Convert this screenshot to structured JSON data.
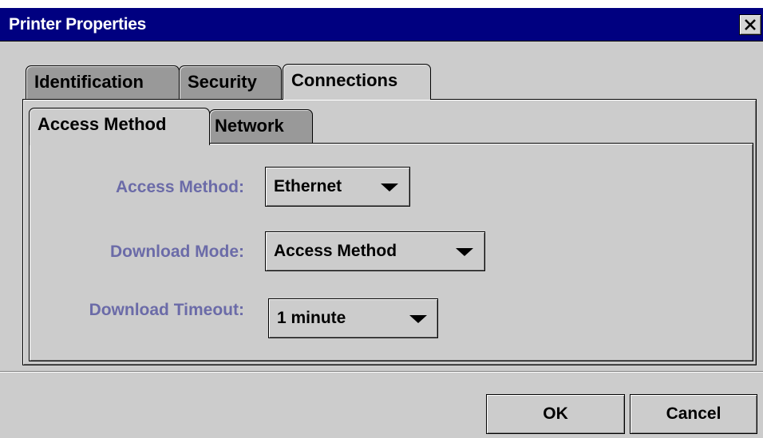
{
  "window": {
    "title": "Printer Properties",
    "close_icon": "close-icon"
  },
  "tabs": [
    {
      "label": "Identification",
      "active": false
    },
    {
      "label": "Security",
      "active": false
    },
    {
      "label": "Connections",
      "active": true
    }
  ],
  "subtabs": [
    {
      "label": "Access Method",
      "active": true
    },
    {
      "label": "Network",
      "active": false
    }
  ],
  "form": {
    "access_method": {
      "label": "Access Method:",
      "value": "Ethernet"
    },
    "download_mode": {
      "label": "Download Mode:",
      "value": "Access Method"
    },
    "download_timeout": {
      "label": "Download Timeout:",
      "value": "1 minute"
    }
  },
  "buttons": {
    "ok": "OK",
    "cancel": "Cancel"
  },
  "colors": {
    "titlebar": "#000080",
    "dialog_bg": "#cccccc",
    "inactive_tab": "#999999",
    "form_label": "#6b6ba8"
  }
}
